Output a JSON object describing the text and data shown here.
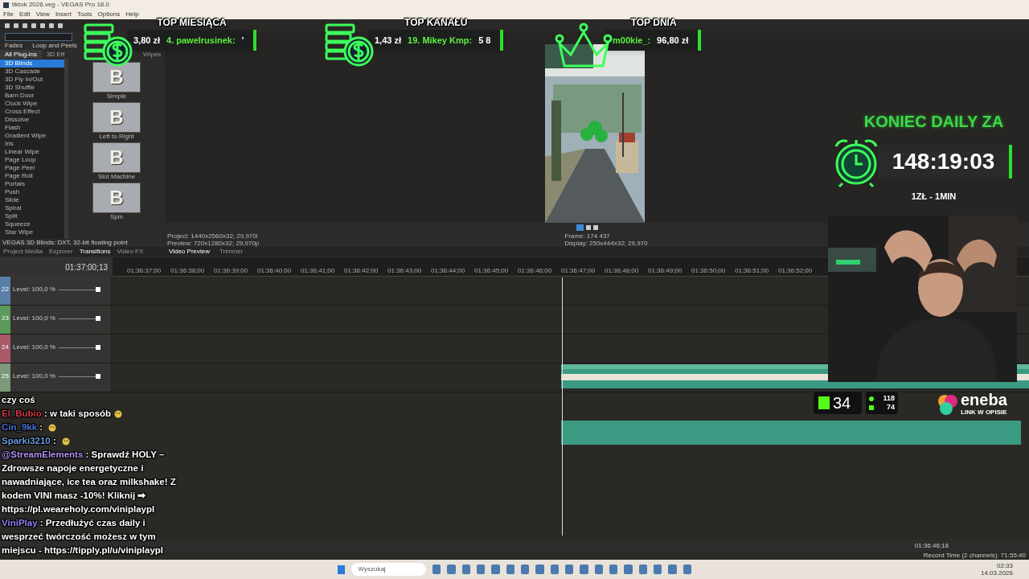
{
  "window": {
    "title": "tiktok 2026.veg - VEGAS Pro 18.0"
  },
  "menu": [
    "File",
    "Edit",
    "View",
    "Insert",
    "Tools",
    "Options",
    "Help"
  ],
  "transitions": {
    "tabs_top": [
      "Fades",
      "Loop and Peels"
    ],
    "tabs_bottom": [
      {
        "label": "All Plug-ins",
        "selected": true
      },
      {
        "label": "3D Eff",
        "selected": false
      }
    ],
    "group": "Wipes",
    "items": [
      {
        "label": "3D Blinds",
        "selected": true
      },
      {
        "label": "3D Cascade",
        "selected": false
      },
      {
        "label": "3D Fly In/Out",
        "selected": false
      },
      {
        "label": "3D Shuffle",
        "selected": false
      },
      {
        "label": "Barn Door",
        "selected": false
      },
      {
        "label": "Clock Wipe",
        "selected": false
      },
      {
        "label": "Cross Effect",
        "selected": false
      },
      {
        "label": "Dissolve",
        "selected": false
      },
      {
        "label": "Flash",
        "selected": false
      },
      {
        "label": "Gradient Wipe",
        "selected": false
      },
      {
        "label": "Iris",
        "selected": false
      },
      {
        "label": "Linear Wipe",
        "selected": false
      },
      {
        "label": "Page Loop",
        "selected": false
      },
      {
        "label": "Page Peel",
        "selected": false
      },
      {
        "label": "Page Roll",
        "selected": false
      },
      {
        "label": "Portals",
        "selected": false
      },
      {
        "label": "Push",
        "selected": false
      },
      {
        "label": "Slide",
        "selected": false
      },
      {
        "label": "Spiral",
        "selected": false
      },
      {
        "label": "Split",
        "selected": false
      },
      {
        "label": "Squeeze",
        "selected": false
      },
      {
        "label": "Star Wipe",
        "selected": false
      }
    ],
    "presets": [
      {
        "label": "Simple",
        "letter": "B"
      },
      {
        "label": "Left to Right",
        "letter": "B"
      },
      {
        "label": "Slot Machine",
        "letter": "B"
      },
      {
        "label": "Spin",
        "letter": "B"
      }
    ],
    "status": "VEGAS 3D Blinds: DXT, 32-bit floating point"
  },
  "dock_tabs": [
    {
      "label": "Project Media",
      "selected": false
    },
    {
      "label": "Explorer",
      "selected": false
    },
    {
      "label": "Transitions",
      "selected": true
    },
    {
      "label": "Video FX",
      "selected": false
    }
  ],
  "preview": {
    "info_left": [
      "Project:  1440x2560x32; 29,970i",
      "Preview:  720x1280x32; 29,970p"
    ],
    "info_right": [
      "Frame:  174 437",
      "Display:  250x444x32; 29,970"
    ],
    "tabs": [
      {
        "label": "Video Preview",
        "selected": true
      },
      {
        "label": "Trimmer",
        "selected": false
      }
    ]
  },
  "timeline": {
    "timecode": "01:37:00;13",
    "ruler": [
      "01:36:37;00",
      "01:36:38;00",
      "01:36:39;00",
      "01:36:40;00",
      "01:36:41;00",
      "01:36:42;00",
      "01:36:43;00",
      "01:36:44;00",
      "01:36:45;00",
      "01:36:46;00",
      "01:36:47;00",
      "01:36:48;00",
      "01:36:49;00",
      "01:36:50;00",
      "01:36:51;00",
      "01:36:52;00"
    ],
    "tracks": [
      {
        "number": "22",
        "level_label": "Level: 100,0 %",
        "level": 1,
        "color": "#5a7fa8"
      },
      {
        "number": "23",
        "level_label": "Level: 100,0 %",
        "level": 1,
        "color": "#5a9a5a"
      },
      {
        "number": "24",
        "level_label": "Level: 100,0 %",
        "level": 1,
        "color": "#a85a6a"
      },
      {
        "number": "25",
        "level_label": "Level: 100,0 %",
        "level": 1,
        "color": "#7a9a7a"
      }
    ],
    "cursor_time": "01:36:46;18",
    "record_time": "Record Time (2 channels): 71:55:40"
  },
  "overlays": {
    "leaders": [
      {
        "title": "TOP MIESIĄCA",
        "kind": "coins",
        "amount": "3,80 zł",
        "name": "4. pawelrusinek:",
        "rest": "'"
      },
      {
        "title": "TOP KANAŁU",
        "kind": "coins",
        "amount": "1,43 zł",
        "name": "19. Mikey Kmp:",
        "rest": "5 8"
      },
      {
        "title": "TOP DNIA",
        "kind": "crown",
        "name": "m00kie_:",
        "rest": "96,80 zł"
      }
    ],
    "timer": {
      "title": "KONIEC DAILY ZA",
      "value": "148:19:03",
      "rate": "1ZŁ - 1MIN"
    },
    "kick": {
      "viewers": "34",
      "followers": "118",
      "subs": "74"
    },
    "sponsor": {
      "name": "eneba",
      "tagline": "LINK W OPISIE"
    }
  },
  "chat": [
    {
      "text": "czy coś"
    },
    {
      "user": "El_Bubio",
      "sep": ":",
      "color": "#d03848",
      "text": "w taki sposób",
      "emote": true
    },
    {
      "user": "Cin_9kk",
      "sep": ":",
      "color": "#4a70d8",
      "emote": true
    },
    {
      "user": "Sparki3210",
      "sep": ":",
      "color": "#6a9ae0",
      "emote": true
    },
    {
      "user": "@StreamElements",
      "sep": ":",
      "color": "#b090f0",
      "text": "Sprawdź HOLY – Zdrowsze napoje energetyczne i nawadniające, ice tea oraz milkshake! Z kodem VINI masz -10%! Kliknij ➡ https://pl.weareholy.com/viniplaypl",
      "emote": false
    },
    {
      "user": "ViniPlay",
      "sep": ":",
      "color": "#9080f0",
      "text": "Przedłużyć czas daily i wesprzeć twórczość możesz w tym miejscu - https://tipply.pl/u/viniplaypl",
      "emote": false
    }
  ],
  "taskbar": {
    "search": "Wyszukaj",
    "time": "02:33",
    "date": "14.03.2026"
  }
}
